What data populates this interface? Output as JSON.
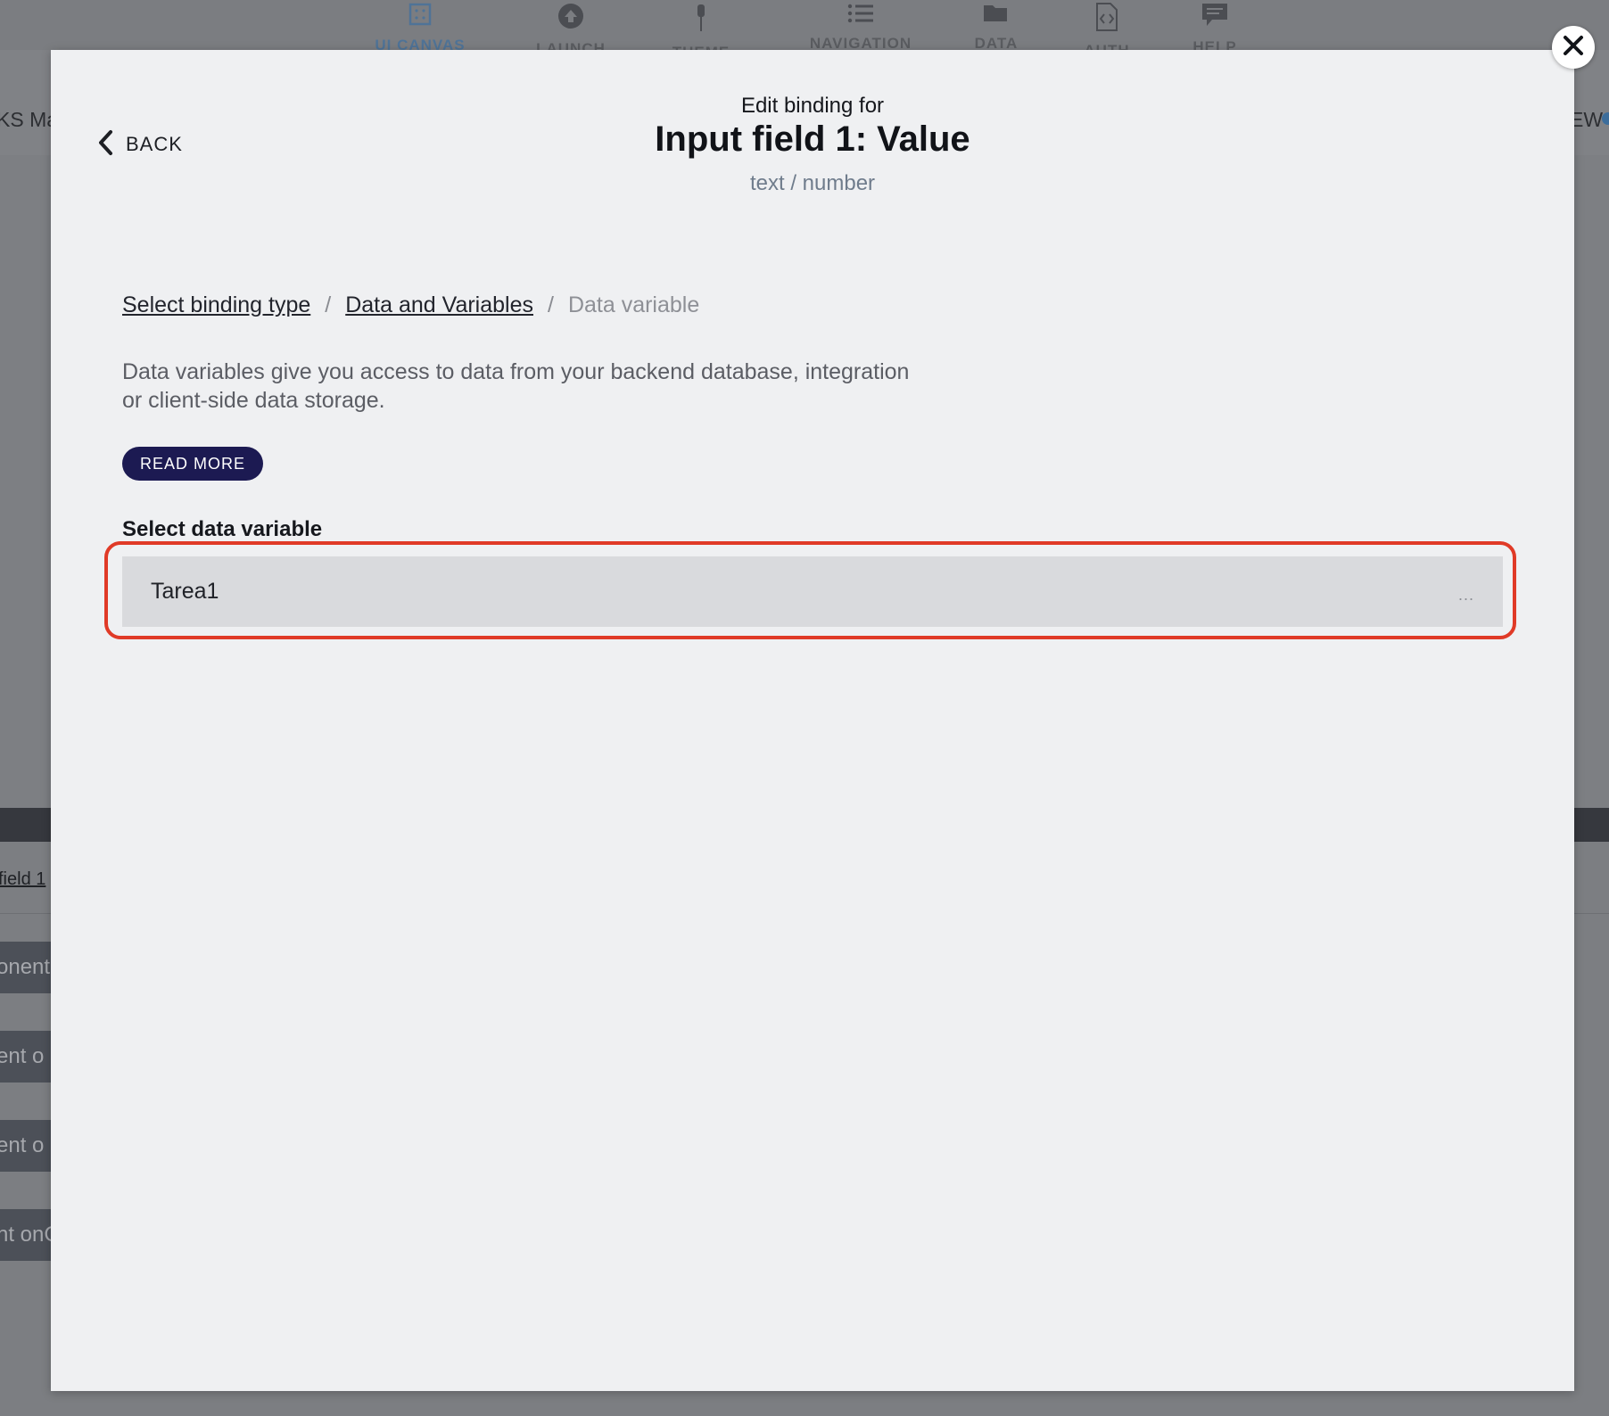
{
  "background": {
    "nav": [
      {
        "label": "UI CANVAS",
        "icon": "canvas-icon"
      },
      {
        "label": "LAUNCH",
        "icon": "upload-icon"
      },
      {
        "label": "THEME",
        "icon": "brush-icon"
      },
      {
        "label": "NAVIGATION",
        "icon": "list-icon"
      },
      {
        "label": "DATA",
        "icon": "folder-icon"
      },
      {
        "label": "AUTH",
        "icon": "code-file-icon"
      },
      {
        "label": "HELP",
        "icon": "chat-icon"
      }
    ],
    "sub_left": "KS Ma",
    "sub_right": "EW",
    "field_link": "field 1",
    "components": [
      "onent",
      "ent o",
      "ent o",
      "nt onC"
    ]
  },
  "modal": {
    "back_label": "BACK",
    "header_small": "Edit binding for",
    "header_title": "Input field 1: Value",
    "header_sub": "text / number",
    "breadcrumb": {
      "item1": "Select binding type",
      "separator": "/",
      "item2": "Data and Variables",
      "item3": "Data variable"
    },
    "description": "Data variables give you access to data from your backend database, integration or client-side data storage.",
    "read_more_label": "READ MORE",
    "field_label": "Select data variable",
    "selected_variable": "Tarea1",
    "more_label": "..."
  },
  "colors": {
    "accent": "#1c1a52",
    "highlight": "#e03a27"
  }
}
